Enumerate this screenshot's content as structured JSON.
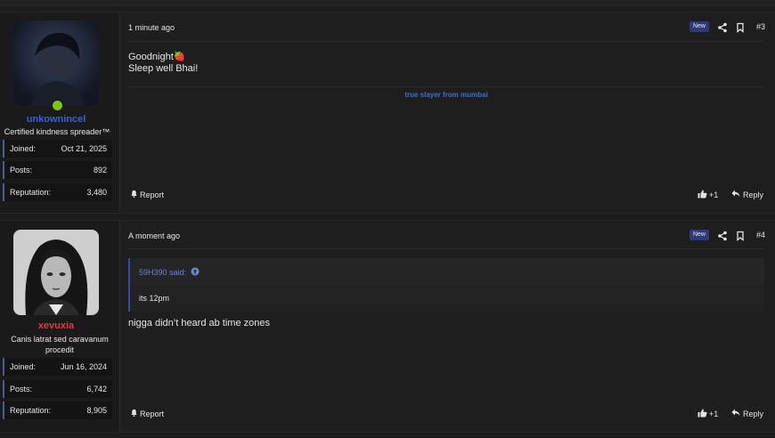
{
  "posts": [
    {
      "user": {
        "name": "unkownincel",
        "title": "Certified kindness spreader™",
        "stats": [
          {
            "label": "Joined:",
            "value": "Oct 21, 2025"
          },
          {
            "label": "Posts:",
            "value": "892"
          },
          {
            "label": "Reputation:",
            "value": "3,480"
          }
        ],
        "online": true
      },
      "time": "1 minute ago",
      "badge": "New",
      "number": "#3",
      "message_lines": [
        "Goodnight🍓",
        "Sleep well Bhai!"
      ],
      "signature": "true slayer from mumbai",
      "report": "Report",
      "like": "+1",
      "reply": "Reply"
    },
    {
      "user": {
        "name": "xevuxia",
        "title": "Canis latrat sed caravanum procedit",
        "stats": [
          {
            "label": "Joined:",
            "value": "Jun 16, 2024"
          },
          {
            "label": "Posts:",
            "value": "6,742"
          },
          {
            "label": "Reputation:",
            "value": "8,905"
          }
        ]
      },
      "time": "A moment ago",
      "badge": "New",
      "number": "#4",
      "quote": {
        "author": "59H390 said:",
        "text": "its 12pm"
      },
      "message": "nigga didn’t heard ab time zones",
      "report": "Report",
      "like": "+1",
      "reply": "Reply"
    }
  ],
  "colors": {
    "accent": "#3b5fd8",
    "username2": "#e23a3a",
    "online": "#7ec417",
    "badge": "#2d3b7a"
  },
  "icons": [
    "share-icon",
    "bookmark-icon",
    "bell-icon",
    "thumbs-up-icon",
    "reply-arrow-icon",
    "arrow-up-circle-icon"
  ]
}
